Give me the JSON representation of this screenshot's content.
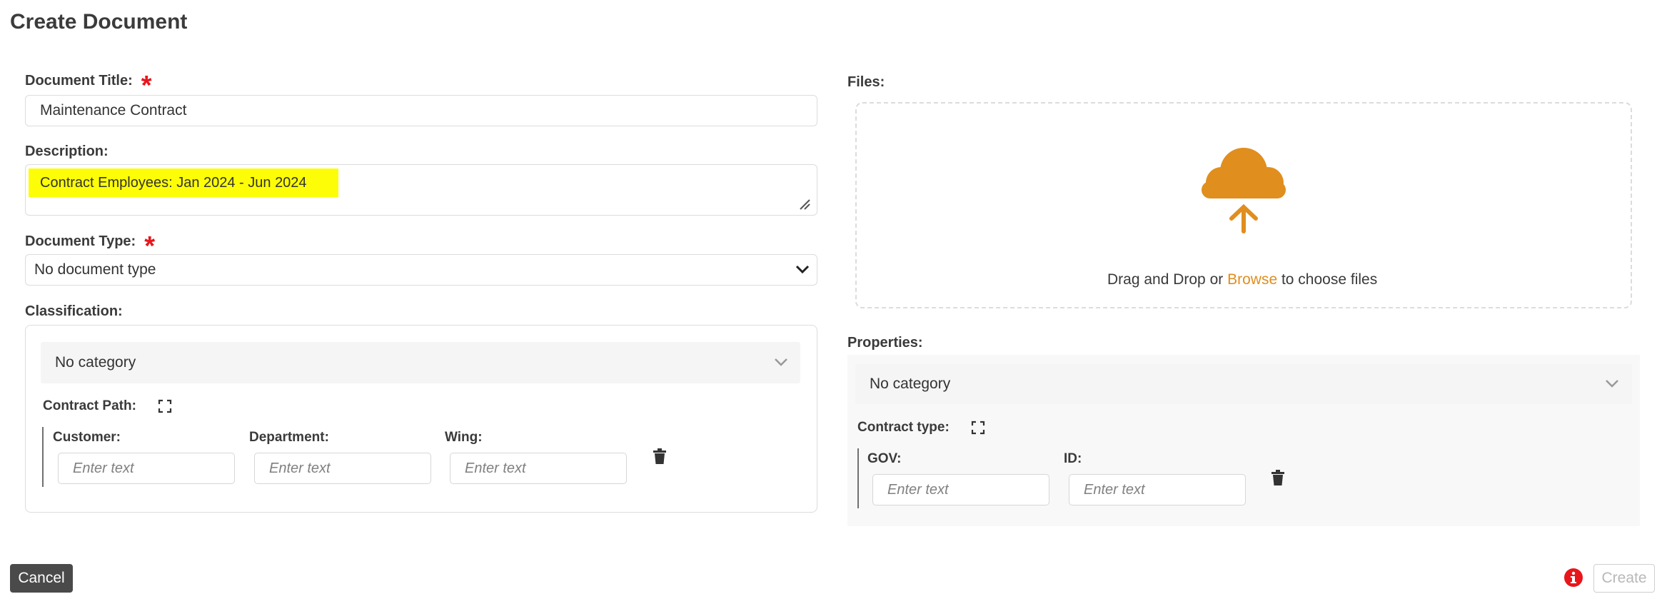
{
  "page": {
    "title": "Create Document"
  },
  "form": {
    "document_title": {
      "label": "Document Title:",
      "value": "Maintenance Contract"
    },
    "description": {
      "label": "Description:",
      "value": "Contract Employees: Jan 2024 - Jun 2024"
    },
    "document_type": {
      "label": "Document Type:",
      "value": "No document type"
    },
    "required_marker": "*"
  },
  "classification": {
    "label": "Classification:",
    "category": "No category",
    "path_label": "Contract Path:",
    "fields": [
      {
        "label": "Customer:",
        "placeholder": "Enter text"
      },
      {
        "label": "Department:",
        "placeholder": "Enter text"
      },
      {
        "label": "Wing:",
        "placeholder": "Enter text"
      }
    ]
  },
  "files": {
    "label": "Files:",
    "drop_text_before": "Drag and Drop or ",
    "browse_label": "Browse",
    "drop_text_after": " to choose files",
    "accent_color": "#e08e1e"
  },
  "properties": {
    "label": "Properties:",
    "category": "No category",
    "type_label": "Contract type:",
    "fields": [
      {
        "label": "GOV:",
        "placeholder": "Enter text"
      },
      {
        "label": "ID:",
        "placeholder": "Enter text"
      }
    ]
  },
  "footer": {
    "cancel_label": "Cancel",
    "create_label": "Create",
    "error_color": "#e8161b"
  }
}
